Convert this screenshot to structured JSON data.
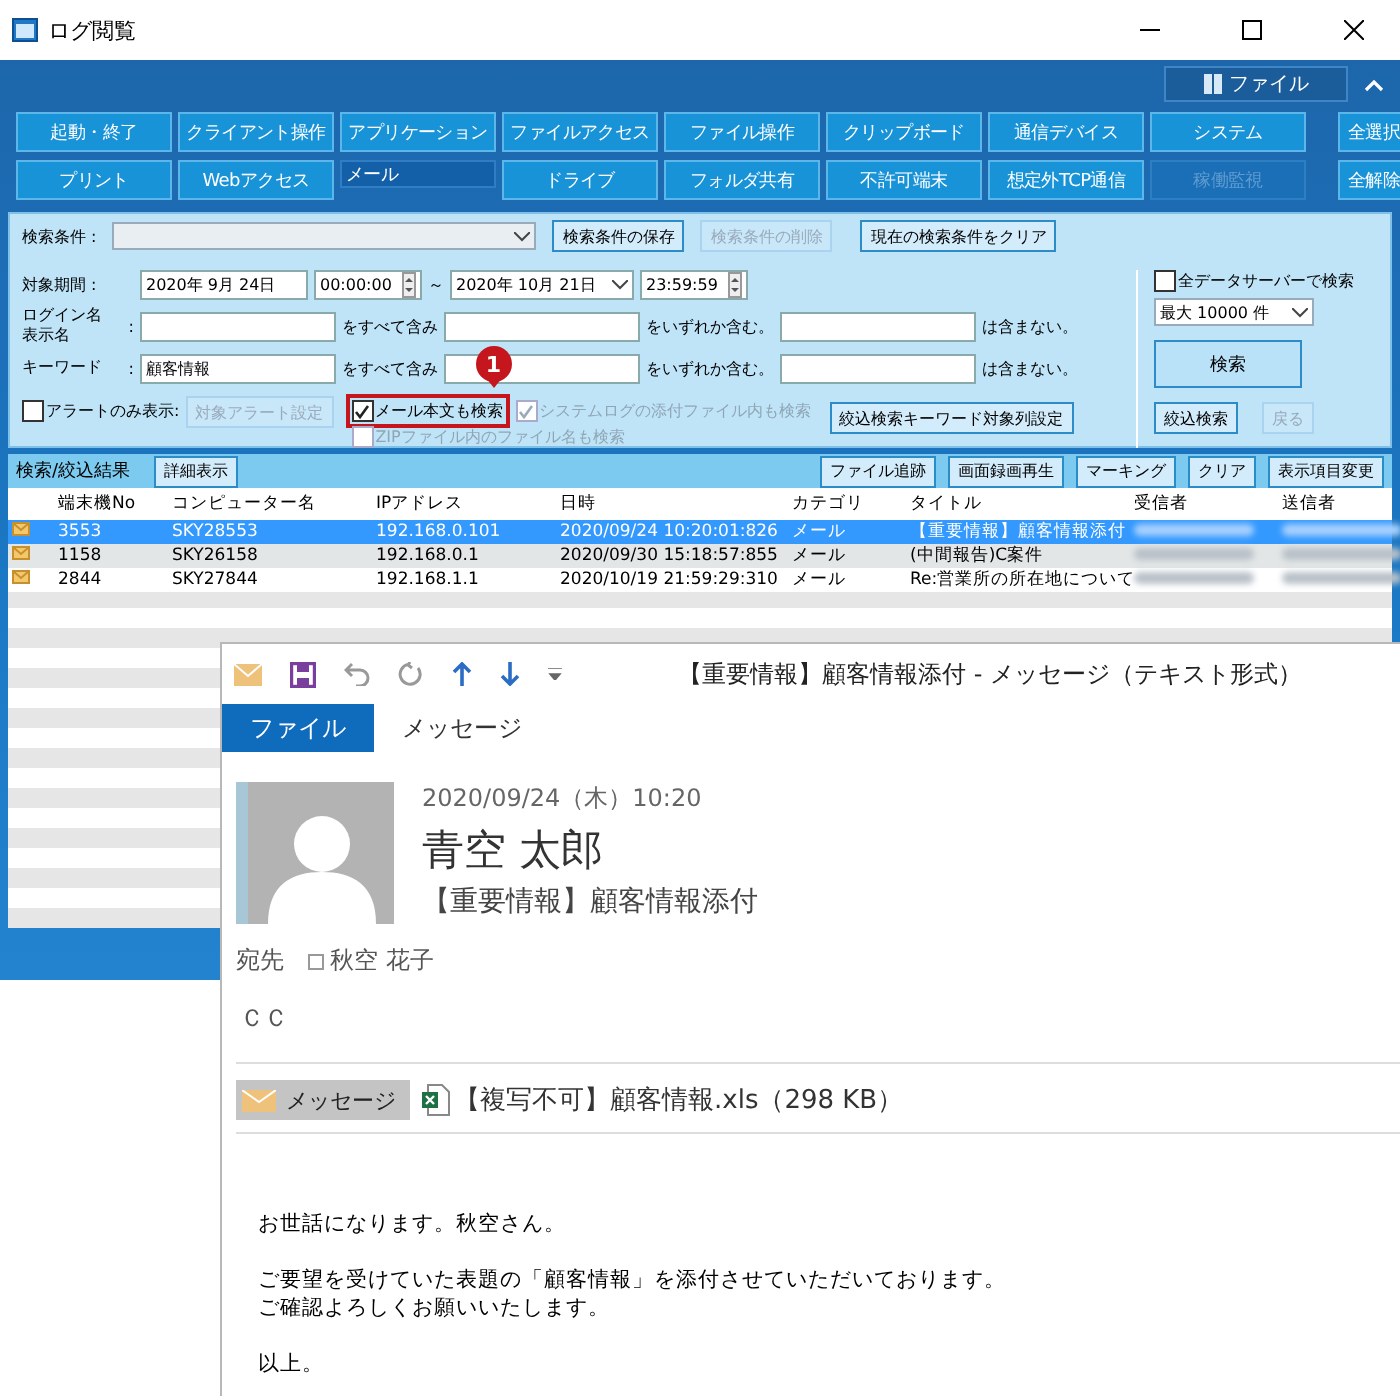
{
  "app_window": {
    "title": "ログ閲覧",
    "ribbon_button": "ファイル",
    "categories": [
      [
        {
          "label": "起動・終了",
          "selected": false,
          "disabled": false
        },
        {
          "label": "クライアント操作",
          "selected": false,
          "disabled": false
        },
        {
          "label": "アプリケーション",
          "selected": false,
          "disabled": false
        },
        {
          "label": "ファイルアクセス",
          "selected": false,
          "disabled": false
        },
        {
          "label": "ファイル操作",
          "selected": false,
          "disabled": false
        },
        {
          "label": "クリップボード",
          "selected": false,
          "disabled": false
        },
        {
          "label": "通信デバイス",
          "selected": false,
          "disabled": false
        },
        {
          "label": "システム",
          "selected": false,
          "disabled": false
        }
      ],
      [
        {
          "label": "プリント",
          "selected": false,
          "disabled": false
        },
        {
          "label": "Webアクセス",
          "selected": false,
          "disabled": false
        },
        {
          "label": "メール",
          "selected": true,
          "disabled": false
        },
        {
          "label": "ドライブ",
          "selected": false,
          "disabled": false
        },
        {
          "label": "フォルダ共有",
          "selected": false,
          "disabled": false
        },
        {
          "label": "不許可端末",
          "selected": false,
          "disabled": false
        },
        {
          "label": "想定外TCP通信",
          "selected": false,
          "disabled": false
        },
        {
          "label": "稼働監視",
          "selected": false,
          "disabled": true
        }
      ]
    ],
    "select_buttons": [
      "全選択",
      "全解除"
    ],
    "search": {
      "condition_label": "検索条件 :",
      "condition_buttons": [
        {
          "label": "検索条件の保存",
          "disabled": false
        },
        {
          "label": "検索条件の削除",
          "disabled": true
        },
        {
          "label": "現在の検索条件をクリア",
          "disabled": false
        }
      ],
      "period_label": "対象期間 :",
      "date_from": "2020年  9月 24日",
      "time_from": "00:00:00",
      "tilde": "～",
      "date_to": "2020年 10月 21日",
      "time_to": "23:59:59",
      "text_rows": [
        {
          "label_lines": [
            "ログイン名",
            "表示名"
          ],
          "colon": ":",
          "fields": [
            {
              "suffix": "をすべて含み"
            },
            {
              "suffix": "をいずれか含む。"
            },
            {
              "suffix": "は含まない。"
            }
          ]
        },
        {
          "label_lines": [
            "キーワード"
          ],
          "colon": ":",
          "fields": [
            {
              "value": "顧客情報",
              "suffix": "をすべて含み"
            },
            {
              "suffix": "をいずれか含む。"
            },
            {
              "suffix": "は含まない。"
            }
          ]
        }
      ],
      "alert_only": {
        "label": "アラートのみ表示:",
        "checked": false
      },
      "alert_settings": {
        "label": "対象アラート設定",
        "disabled": true
      },
      "options": [
        {
          "label": "メール本文も検索",
          "checked": true,
          "disabled": false,
          "highlighted": true
        },
        {
          "label": "システムログの添付ファイル内も検索",
          "checked": true,
          "disabled": true,
          "highlighted": false
        },
        {
          "label": "ZIPファイル内のファイル名も検索",
          "checked": false,
          "disabled": true,
          "highlighted": false
        }
      ],
      "keyword_column_button": "絞込検索キーワード対象列設定",
      "all_servers": {
        "label": "全データサーバーで検索",
        "checked": false
      },
      "max_rows": "最大 10000 件",
      "search_button": "検索",
      "refine_button": {
        "label": "絞込検索",
        "disabled": false
      },
      "back_button": {
        "label": "戻る",
        "disabled": true
      }
    },
    "annotation": {
      "number": "1"
    },
    "results": {
      "label": "検索/絞込結果",
      "detail_button": "詳細表示",
      "tools": [
        "ファイル追跡",
        "画面録画再生",
        "マーキング",
        "クリア",
        "表示項目変更"
      ]
    },
    "table": {
      "columns": [
        "端末機No",
        "コンピューター名",
        "IPアドレス",
        "日時",
        "カテゴリ",
        "タイトル",
        "受信者",
        "送信者"
      ],
      "rows": [
        {
          "selected": true,
          "cells": [
            "3553",
            "SKY28553",
            "192.168.0.101",
            "2020/09/24  10:20:01:826",
            "メール",
            "【重要情報】顧客情報添付"
          ]
        },
        {
          "selected": false,
          "cells": [
            "1158",
            "SKY26158",
            "192.168.0.1",
            "2020/09/30  15:18:57:855",
            "メール",
            "(中間報告)C案件"
          ]
        },
        {
          "selected": false,
          "cells": [
            "2844",
            "SKY27844",
            "192.168.1.1",
            "2020/10/19  21:59:29:310",
            "メール",
            "Re:営業所の所在地について"
          ]
        }
      ]
    }
  },
  "mail_window": {
    "title": "【重要情報】顧客情報添付 - メッセージ（テキスト形式）",
    "tabs": [
      {
        "label": "ファイル",
        "selected": true
      },
      {
        "label": "メッセージ",
        "selected": false
      }
    ],
    "sent": "2020/09/24（木）10:20",
    "sender": "青空 太郎",
    "subject": "【重要情報】顧客情報添付",
    "to_label": "宛先",
    "to": "秋空 花子",
    "cc_label": "ＣＣ",
    "attachments": [
      {
        "kind": "message",
        "label": "メッセージ",
        "selected": true
      },
      {
        "kind": "file",
        "label": "【複写不可】顧客情報.xls（298 KB）",
        "selected": false
      }
    ],
    "body": [
      [
        "お世話になります。秋空さん。"
      ],
      [
        "ご要望を受けていた表題の「顧客情報」を添付させていただいております。",
        "ご確認よろしくお願いいたします。"
      ],
      [
        "以上。"
      ]
    ]
  }
}
